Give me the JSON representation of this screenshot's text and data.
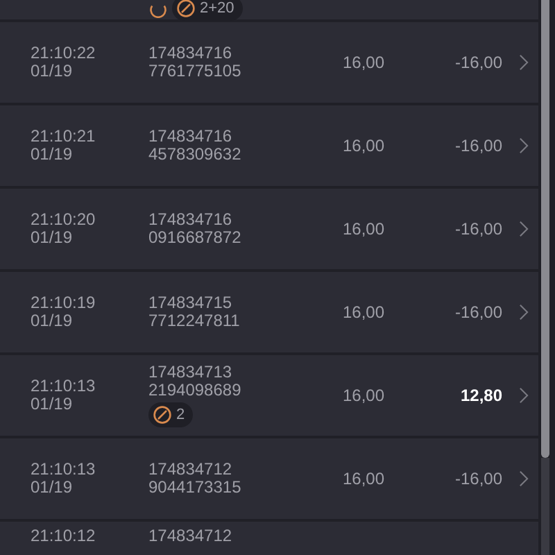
{
  "top_partial_row": {
    "badge_count": "2+20"
  },
  "rows": [
    {
      "time": "21:10:22",
      "date": "01/19",
      "id_line_1": "174834716",
      "id_line_2": "7761775105",
      "amount": "16,00",
      "result": "-16,00",
      "highlighted": false
    },
    {
      "time": "21:10:21",
      "date": "01/19",
      "id_line_1": "174834716",
      "id_line_2": "4578309632",
      "amount": "16,00",
      "result": "-16,00",
      "highlighted": false
    },
    {
      "time": "21:10:20",
      "date": "01/19",
      "id_line_1": "174834716",
      "id_line_2": "0916687872",
      "amount": "16,00",
      "result": "-16,00",
      "highlighted": false
    },
    {
      "time": "21:10:19",
      "date": "01/19",
      "id_line_1": "174834715",
      "id_line_2": "7712247811",
      "amount": "16,00",
      "result": "-16,00",
      "highlighted": false
    },
    {
      "time": "21:10:13",
      "date": "01/19",
      "id_line_1": "174834713",
      "id_line_2": "2194098689",
      "badge_count": "2",
      "amount": "16,00",
      "result": "12,80",
      "highlighted": true
    },
    {
      "time": "21:10:13",
      "date": "01/19",
      "id_line_1": "174834712",
      "id_line_2": "9044173315",
      "amount": "16,00",
      "result": "-16,00",
      "highlighted": false
    }
  ],
  "bottom_partial_row": {
    "time": "21:10:12",
    "id_line_1": "174834712"
  }
}
